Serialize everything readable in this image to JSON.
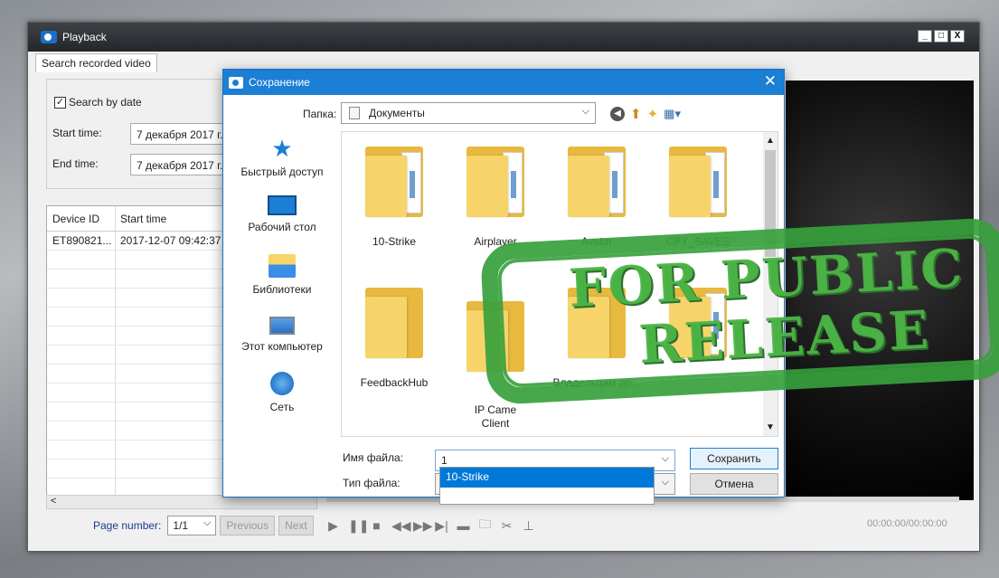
{
  "playback": {
    "title": "Playback",
    "window_buttons": [
      "_",
      "□",
      "X"
    ],
    "tab": "Search recorded video",
    "search": {
      "search_by_date_label": "Search by date",
      "search_by_date_checked": true,
      "start_label": "Start time:",
      "start_value": "7 декабря  2017 г.",
      "end_label": "End time:",
      "end_value": "7 декабря  2017 г."
    },
    "table": {
      "columns": [
        "Device ID",
        "Start time"
      ],
      "rows": [
        [
          "ET890821...",
          "2017-12-07 09:42:37"
        ]
      ]
    },
    "pager": {
      "label": "Page number:",
      "page": "1/1",
      "previous": "Previous",
      "next": "Next"
    },
    "time_readout": "00:00:00/00:00:00",
    "control_icons": [
      "play-icon",
      "pause-icon",
      "stop-icon",
      "rewind-icon",
      "fast-forward-icon",
      "step-icon",
      "snapshot-icon",
      "folder-icon",
      "cut-start-icon",
      "cut-end-icon"
    ]
  },
  "save_dialog": {
    "title": "Сохранение",
    "folder_label": "Папка:",
    "folder_value": "Документы",
    "places": [
      {
        "label": "Быстрый доступ",
        "icon": "quick-access-icon"
      },
      {
        "label": "Рабочий стол",
        "icon": "desktop-icon"
      },
      {
        "label": "Библиотеки",
        "icon": "libraries-icon"
      },
      {
        "label": "Этот компьютер",
        "icon": "this-pc-icon"
      },
      {
        "label": "Сеть",
        "icon": "network-icon"
      }
    ],
    "files": [
      "10-Strike",
      "Airplayer",
      "Avatar",
      "CPY_SAVES",
      "FeedbackHub",
      "IP Came\nClient",
      "Владельцам до...",
      ""
    ],
    "filename_label": "Имя файла:",
    "filename_value": "1",
    "filetype_label": "Тип файла:",
    "save_button": "Сохранить",
    "cancel_button": "Отмена",
    "autocomplete_item": "10-Strike"
  },
  "stamp": {
    "line1": "FOR PUBLIC",
    "line2": "RELEASE"
  }
}
